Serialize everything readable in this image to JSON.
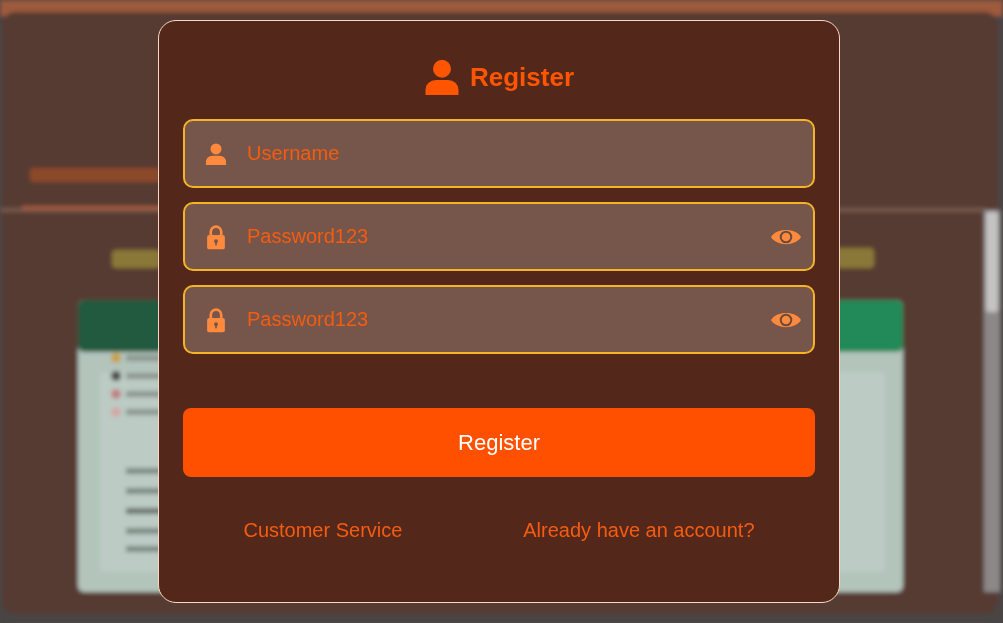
{
  "dialog": {
    "title": "Register",
    "fields": [
      {
        "kind": "username",
        "placeholder": "Username"
      },
      {
        "kind": "password",
        "value": "Password123",
        "revealed": true
      },
      {
        "kind": "password",
        "value": "Password123",
        "revealed": true
      }
    ],
    "submit_button": "Register",
    "links": [
      "Customer Service",
      "Already have an account?"
    ]
  }
}
